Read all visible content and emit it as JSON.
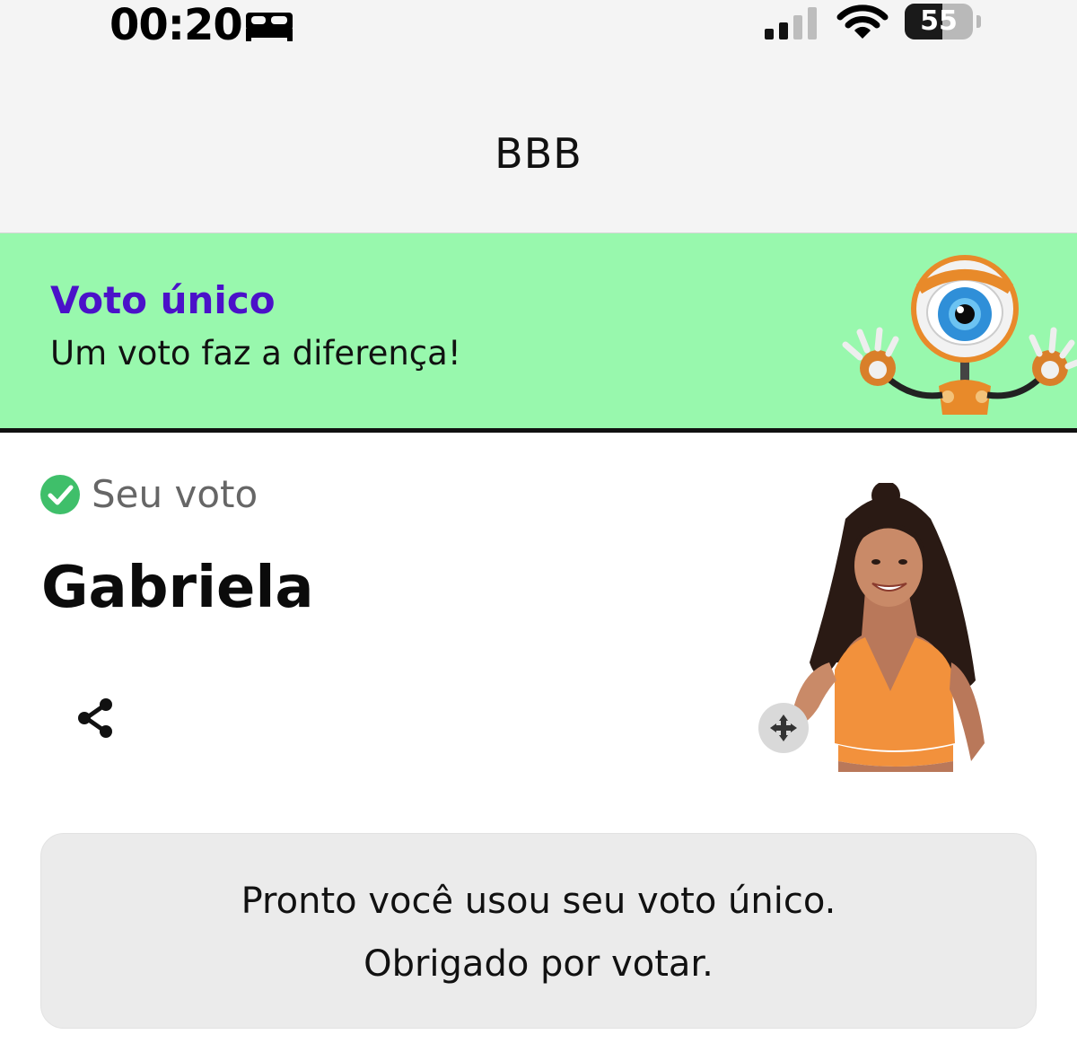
{
  "status_bar": {
    "time": "00:20",
    "focus_icon": "bed-icon",
    "signal_icon": "cellular-signal-icon",
    "wifi_icon": "wifi-icon",
    "battery_percent": "55",
    "battery_level": 0.55
  },
  "nav": {
    "title": "BBB"
  },
  "banner": {
    "title": "Voto único",
    "subtitle": "Um voto faz a diferença!",
    "background_color": "#98f8ad",
    "title_color": "#4b11c9",
    "mascot_icon": "big-brother-eye-mascot"
  },
  "vote": {
    "status_icon": "check-circle-icon",
    "status_label": "Seu voto",
    "candidate_name": "Gabriela",
    "share_icon": "share-icon",
    "move_icon": "move-arrows-icon",
    "photo": "candidate-photo"
  },
  "message": {
    "line1": "Pronto você usou seu voto único.",
    "line2": "Obrigado por votar."
  }
}
